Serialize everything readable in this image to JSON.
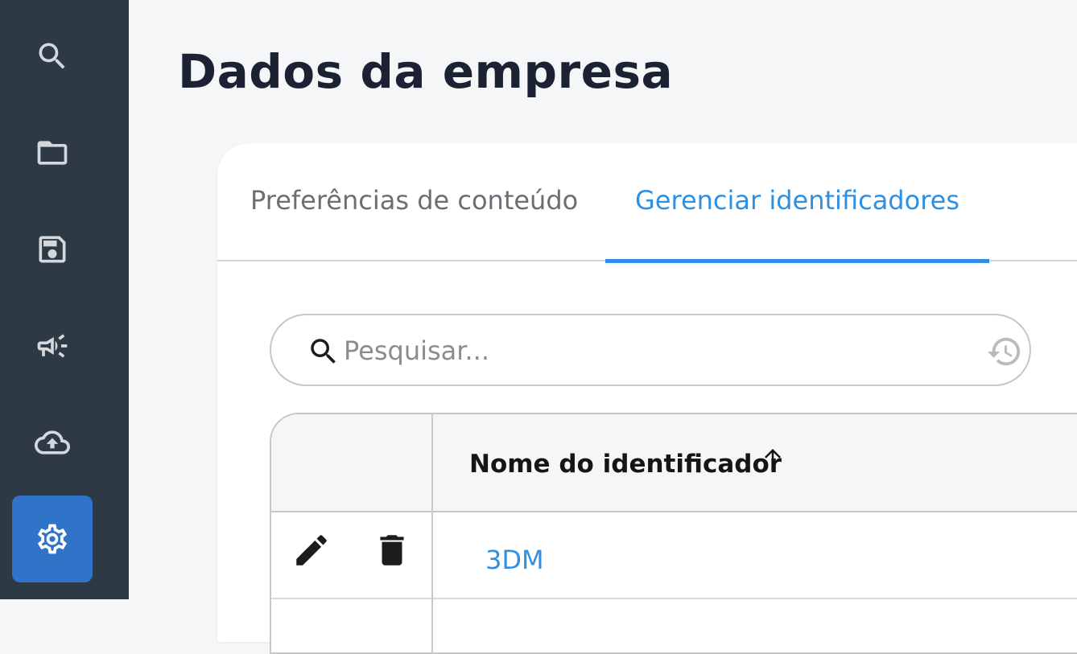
{
  "page": {
    "title": "Dados da empresa"
  },
  "sidebar": {
    "items": [
      {
        "icon": "search-icon"
      },
      {
        "icon": "folder-icon"
      },
      {
        "icon": "save-icon"
      },
      {
        "icon": "megaphone-icon"
      },
      {
        "icon": "cloud-upload-icon"
      },
      {
        "icon": "gear-icon",
        "active": true
      }
    ]
  },
  "tabs": [
    {
      "label": "Preferências de conteúdo"
    },
    {
      "label": "Gerenciar identificadores",
      "active": true
    }
  ],
  "search": {
    "placeholder": "Pesquisar..."
  },
  "table": {
    "columns": [
      "Nome do identificador"
    ],
    "rows": [
      {
        "name": "3DM"
      }
    ]
  },
  "colors": {
    "accent": "#2f8fe0",
    "sidebar_bg": "#2e3946",
    "active_nav": "#2f74c8"
  }
}
